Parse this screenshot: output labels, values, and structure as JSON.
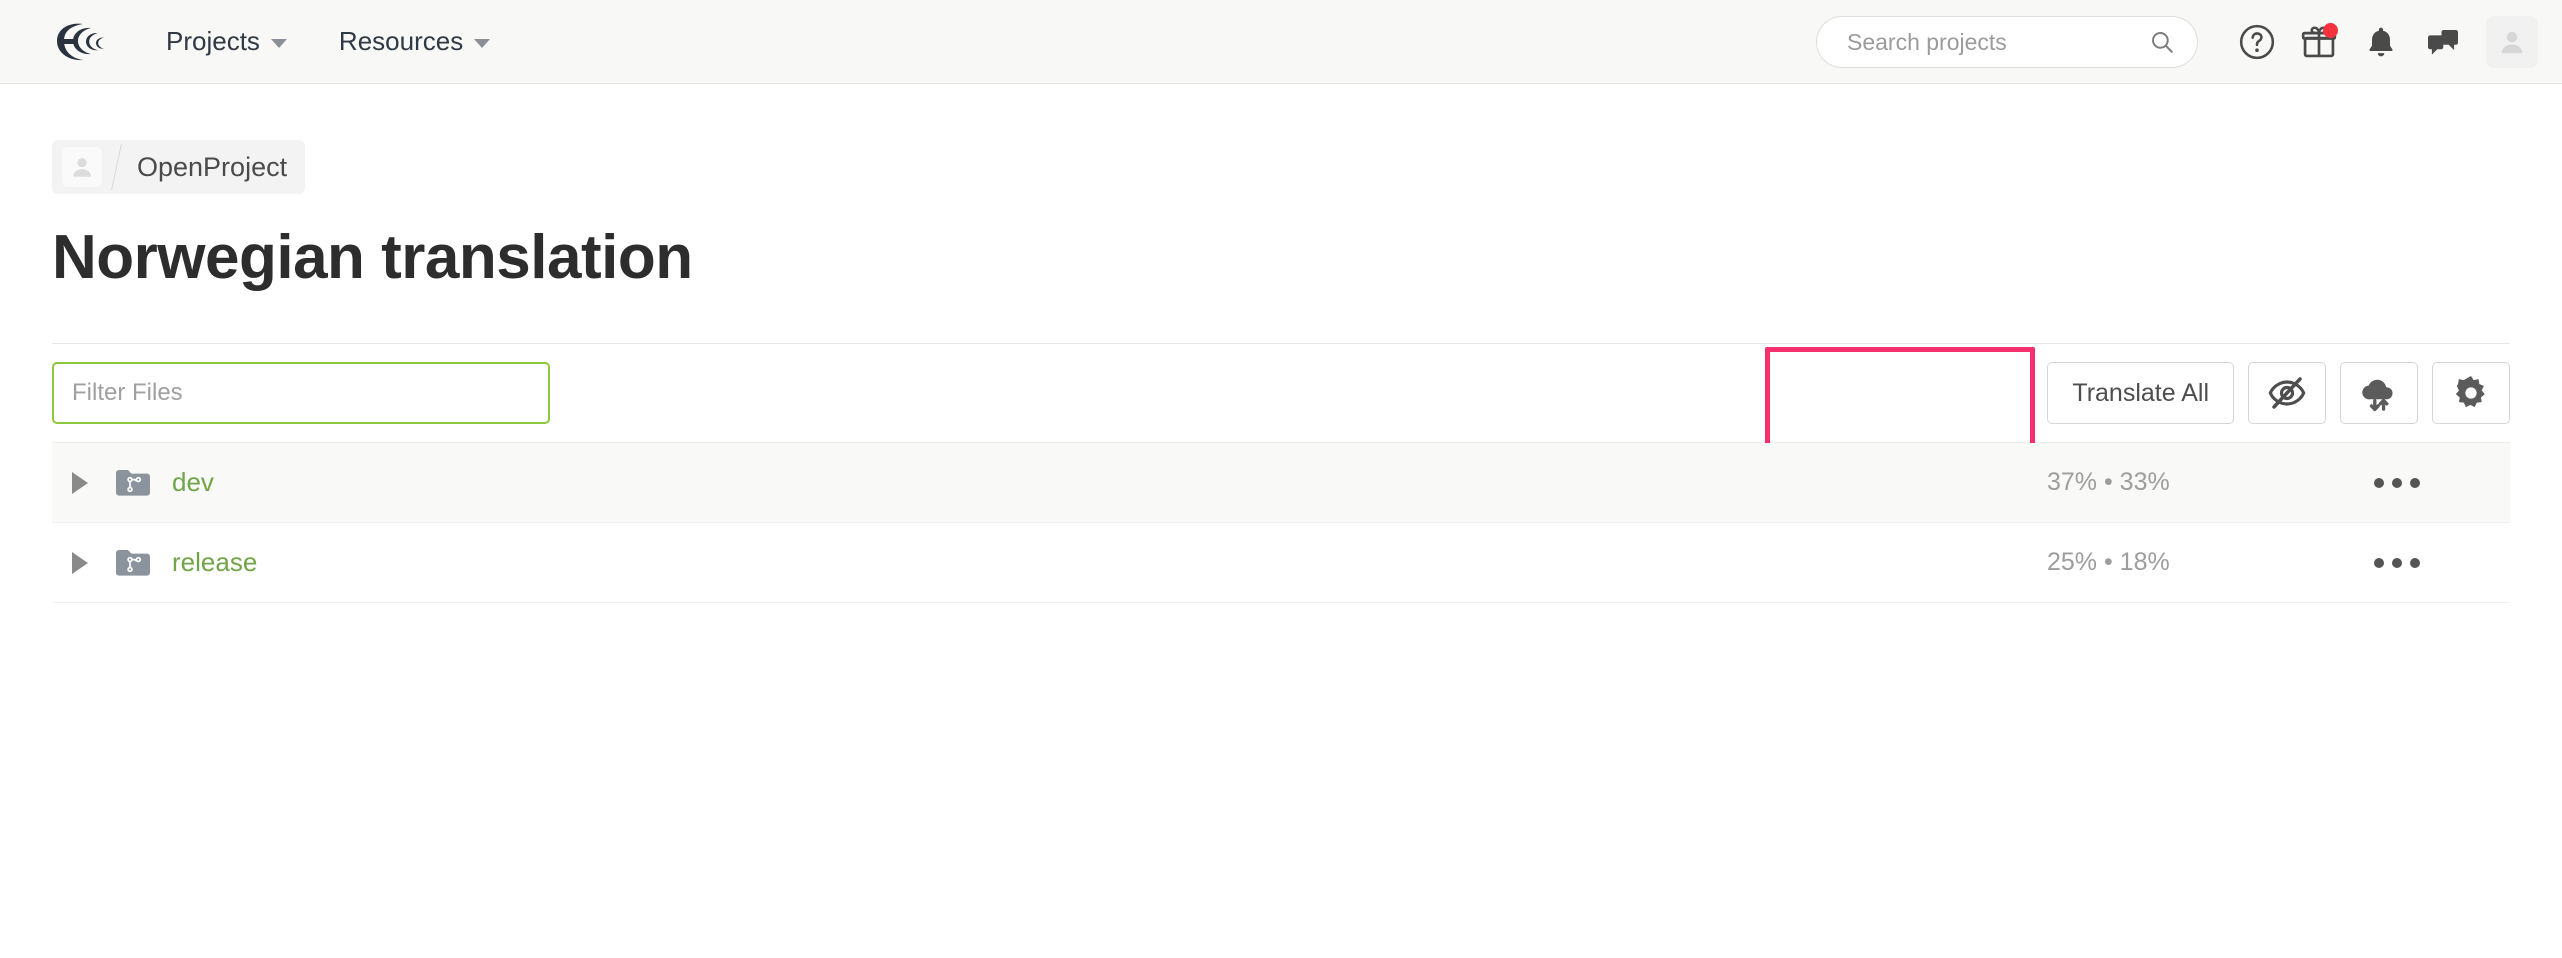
{
  "navbar": {
    "logo_icon": "crowdin-logo-icon",
    "menu": [
      {
        "label": "Projects",
        "icon": "chevron-down-icon"
      },
      {
        "label": "Resources",
        "icon": "chevron-down-icon"
      }
    ],
    "search": {
      "placeholder": "Search projects",
      "value": "",
      "icon": "search-icon"
    },
    "actions": [
      {
        "name": "help-icon",
        "glyph": "?"
      },
      {
        "name": "gift-icon",
        "glyph": "gift",
        "badge": true
      },
      {
        "name": "bell-icon",
        "glyph": "bell"
      },
      {
        "name": "messages-icon",
        "glyph": "chat"
      }
    ],
    "avatar_icon": "user-avatar-icon"
  },
  "breadcrumb": {
    "avatar_icon": "user-avatar-icon",
    "project": "OpenProject"
  },
  "page": {
    "title": "Norwegian translation"
  },
  "toolbar": {
    "filter_placeholder": "Filter Files",
    "filter_value": "",
    "translate_all_label": "Translate All",
    "buttons": [
      {
        "name": "hide-strings-button",
        "icon": "eye-off-icon"
      },
      {
        "name": "sync-button",
        "icon": "cloud-sync-icon"
      },
      {
        "name": "settings-button",
        "icon": "gear-icon"
      }
    ],
    "highlight_color": "#f52f6e"
  },
  "files": [
    {
      "name": "dev",
      "icon": "folder-branch-icon",
      "expander_icon": "triangle-right-icon",
      "translated_percent": 37,
      "approved_percent": 33,
      "stats_label": "37% • 33%",
      "menu_icon": "ellipsis-icon",
      "hovered": true
    },
    {
      "name": "release",
      "icon": "folder-branch-icon",
      "expander_icon": "triangle-right-icon",
      "translated_percent": 25,
      "approved_percent": 18,
      "stats_label": "25% • 18%",
      "menu_icon": "ellipsis-icon",
      "hovered": false
    }
  ],
  "colors": {
    "progress_translated": "#4da6ea",
    "progress_approved": "#8cc522",
    "progress_track": "#ebebeb",
    "link_green": "#71a548",
    "accent_focus": "#8dc63f"
  }
}
